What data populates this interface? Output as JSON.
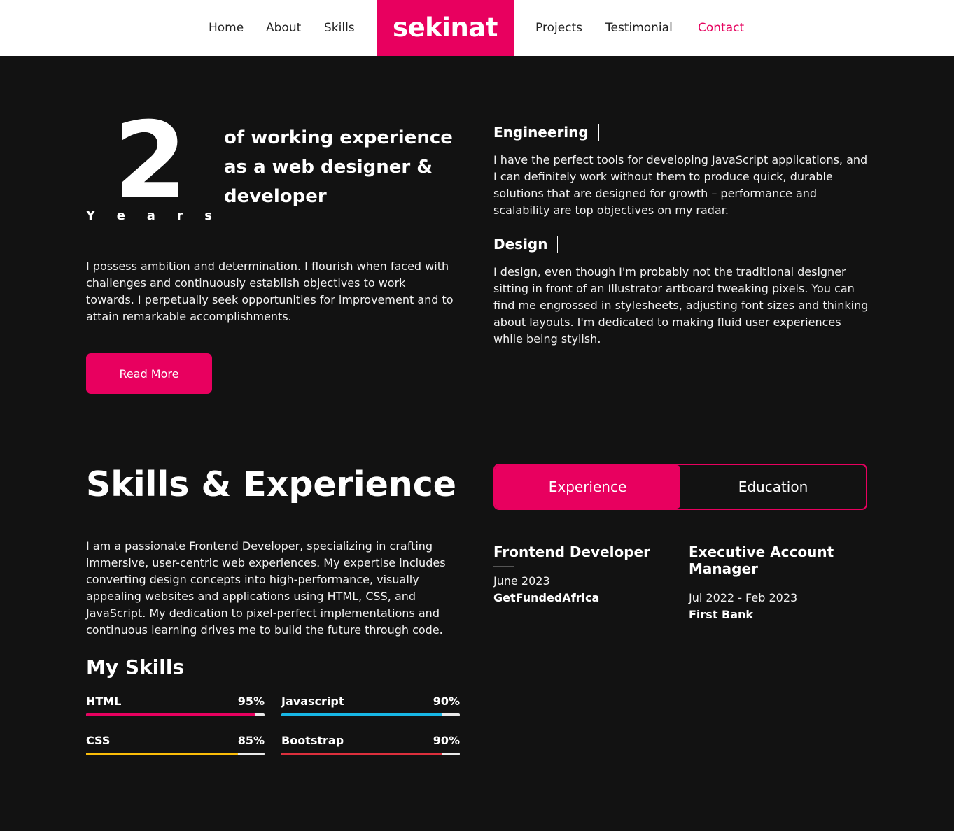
{
  "nav": {
    "brand": "sekinat",
    "links": [
      {
        "label": "Home"
      },
      {
        "label": "About"
      },
      {
        "label": "Skills"
      },
      {
        "label": "Projects"
      },
      {
        "label": "Testimonial"
      },
      {
        "label": "Contact"
      }
    ],
    "active_link": "Contact"
  },
  "hero": {
    "years_number": "2",
    "years_label": [
      "Y",
      "e",
      "a",
      "r",
      "s"
    ],
    "headline": "of working experience as a web designer & developer",
    "intro": "I possess ambition and determination. I flourish when faced with challenges and continuously establish objectives to work towards. I perpetually seek opportunities for improvement and to attain remarkable accomplishments.",
    "read_more_label": "Read More"
  },
  "features": [
    {
      "title": "Engineering",
      "text": "I have the perfect tools for developing JavaScript applications, and I can definitely work without them to produce quick, durable solutions that are designed for growth – performance and scalability are top objectives on my radar."
    },
    {
      "title": "Design",
      "text": "I design, even though I'm probably not the traditional designer sitting in front of an Illustrator artboard tweaking pixels. You can find me engrossed in stylesheets, adjusting font sizes and thinking about layouts. I'm dedicated to making fluid user experiences while being stylish."
    }
  ],
  "skills_section": {
    "title": "Skills & Experience",
    "intro": "I am a passionate Frontend Developer, specializing in crafting immersive, user-centric web experiences. My expertise includes converting design concepts into high-performance, visually appealing websites and applications using HTML, CSS, and JavaScript. My dedication to pixel-perfect implementations and continuous learning drives me to build the future through code.",
    "my_skills_title": "My Skills",
    "skills": [
      {
        "name": "HTML",
        "value_label": "95%",
        "value": 95,
        "color": "#e8005f"
      },
      {
        "name": "Javascript",
        "value_label": "90%",
        "value": 90,
        "color": "#17b7e6"
      },
      {
        "name": "CSS",
        "value_label": "85%",
        "value": 85,
        "color": "#fbbd08"
      },
      {
        "name": "Bootstrap",
        "value_label": "90%",
        "value": 90,
        "color": "#dc2f3c"
      }
    ]
  },
  "tabs": {
    "experience": "Experience",
    "education": "Education",
    "active": "Experience"
  },
  "jobs": [
    {
      "title": "Frontend Developer",
      "period": "June 2023",
      "company": "GetFundedAfrica"
    },
    {
      "title": "Executive Account Manager",
      "period": "Jul 2022 - Feb 2023",
      "company": "First Bank"
    }
  ],
  "colors": {
    "accent": "#e8005f",
    "background": "#121212",
    "nav_background": "#ffffff"
  }
}
